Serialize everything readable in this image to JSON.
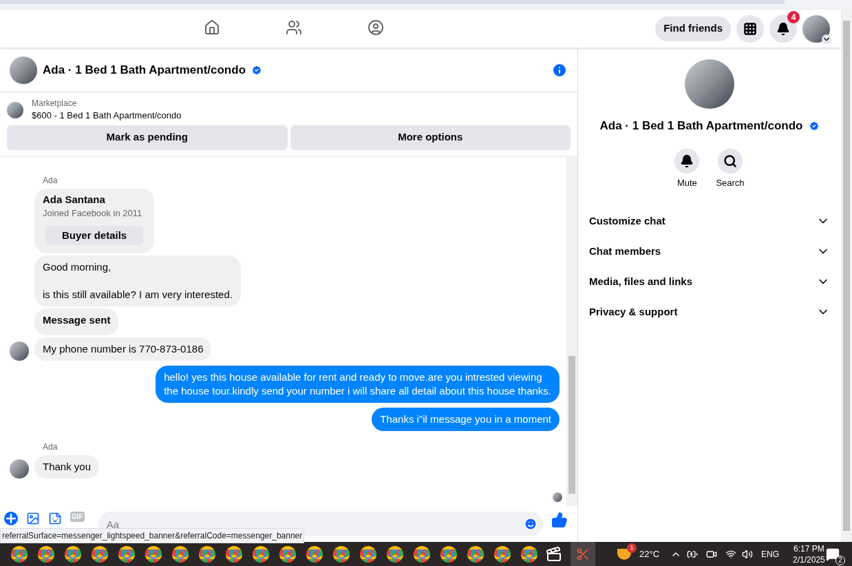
{
  "nav": {
    "find_friends": "Find friends",
    "notifications_badge": "4"
  },
  "chat": {
    "title": "Ada · 1 Bed 1 Bath Apartment/condo",
    "verified": true,
    "listing": {
      "source": "Marketplace",
      "item": "$600 - 1 Bed 1 Bath Apartment/condo"
    },
    "actions": [
      "Mark as pending",
      "More options"
    ],
    "messages": [
      {
        "kind": "sender",
        "text": "Ada"
      },
      {
        "kind": "card",
        "name": "Ada Santana",
        "subtitle": "Joined Facebook in 2011",
        "button": "Buyer details"
      },
      {
        "kind": "in",
        "text": "Good morning,\n\nis this still available? I am very interested.",
        "avatar": false,
        "bold": false
      },
      {
        "kind": "in",
        "text": "Message sent",
        "avatar": false,
        "bold": true
      },
      {
        "kind": "in",
        "text": "My phone number is 770-873-0186",
        "avatar": true,
        "bold": false
      },
      {
        "kind": "out",
        "text": "hello! yes this house available for rent and ready to move.are you intrested viewing\nthe house tour.kindly send your number i will share all detail about this house thanks."
      },
      {
        "kind": "out",
        "text": "Thanks i\"il message you in a moment"
      },
      {
        "kind": "sender",
        "text": "Ada"
      },
      {
        "kind": "in",
        "text": "Thank you",
        "avatar": true,
        "bold": false
      }
    ],
    "composer": {
      "placeholder": "Aa",
      "gif": "GIF"
    },
    "status_url": "referralSurface=messenger_lightspeed_banner&referralCode=messenger_banner"
  },
  "details": {
    "title": "Ada · 1 Bed 1 Bath Apartment/condo",
    "verified": true,
    "actions": [
      {
        "kind": "mute",
        "label": "Mute"
      },
      {
        "kind": "search",
        "label": "Search"
      }
    ],
    "sections": [
      {
        "label": "Customize chat",
        "expanded": false
      },
      {
        "label": "Chat members",
        "expanded": false
      },
      {
        "label": "Media, files and links",
        "expanded": false
      },
      {
        "label": "Privacy & support",
        "expanded": false
      }
    ]
  },
  "taskbar": {
    "weather_badge": "1",
    "temperature": "22°C",
    "language": "ENG",
    "time": "6:17 PM",
    "date": "2/1/2025",
    "notifications": "2"
  }
}
